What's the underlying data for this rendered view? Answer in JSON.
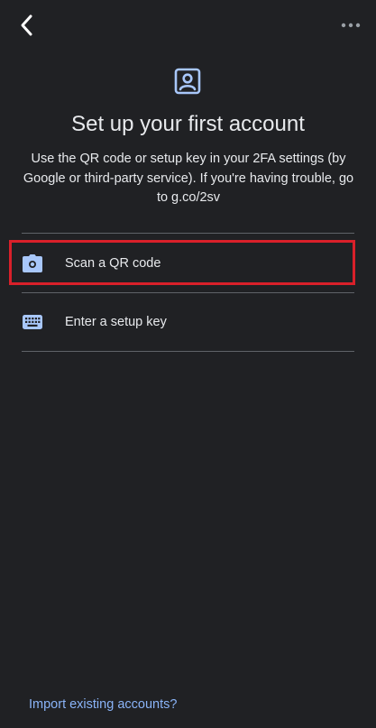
{
  "header": {
    "back_icon": "chevron-left-icon",
    "more_icon": "more-horizontal-icon",
    "account_icon": "account-box-icon"
  },
  "main": {
    "title": "Set up your first account",
    "subtitle": "Use the QR code or setup key in your 2FA settings (by Google or third-party service). If you're having trouble, go to g.co/2sv",
    "options": [
      {
        "label": "Scan a QR code",
        "icon": "camera-icon"
      },
      {
        "label": "Enter a setup key",
        "icon": "keyboard-icon"
      }
    ]
  },
  "footer": {
    "import_label": "Import existing accounts?"
  },
  "colors": {
    "background": "#202124",
    "text": "#e8eaed",
    "accent": "#8ab4f8",
    "icon_tint": "#a8c7fa",
    "divider": "#5f6368",
    "highlight": "#d9202a"
  }
}
